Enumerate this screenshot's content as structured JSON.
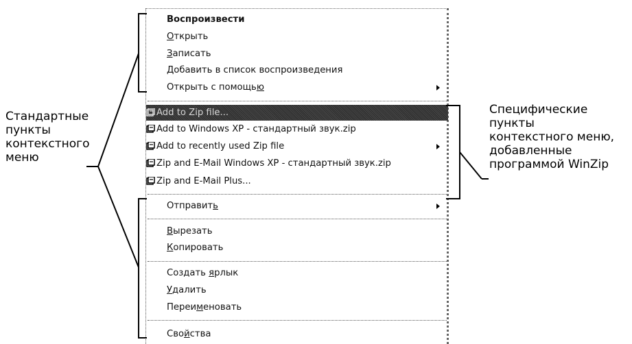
{
  "menu": {
    "items": [
      {
        "label": "Воспроизвести",
        "bold": true
      },
      {
        "label": "Открыть",
        "u": "О"
      },
      {
        "label": "Записать",
        "u": "З"
      },
      {
        "label": "Добавить в список воспроизведения"
      },
      {
        "label": "Открыть с помощью",
        "u": "ю",
        "submenu": true
      },
      {
        "label": "Add to Zip file...",
        "zip": true,
        "highlight": true
      },
      {
        "label": "Add to Windows XP - стандартный звук.zip",
        "zip": true
      },
      {
        "label": "Add to recently used Zip file",
        "zip": true,
        "submenu": true
      },
      {
        "label": "Zip and E-Mail Windows XP - стандартный звук.zip",
        "zip": true
      },
      {
        "label": "Zip and E-Mail Plus...",
        "zip": true
      },
      {
        "label": "Отправить",
        "u": "ь",
        "submenu": true
      },
      {
        "label": "Вырезать",
        "u": "В"
      },
      {
        "label": "Копировать",
        "u": "К"
      },
      {
        "label": "Создать ярлык",
        "u": "я"
      },
      {
        "label": "Удалить",
        "u": "У"
      },
      {
        "label": "Переименовать",
        "u": "м"
      },
      {
        "label": "Свойства",
        "u": "й"
      }
    ]
  },
  "annotations": {
    "left": [
      "Стандартные",
      "пункты",
      "контекстного",
      "меню"
    ],
    "right": [
      "Специфические",
      "пункты",
      "контекстного меню,",
      "добавленные",
      "программой WinZip"
    ]
  }
}
